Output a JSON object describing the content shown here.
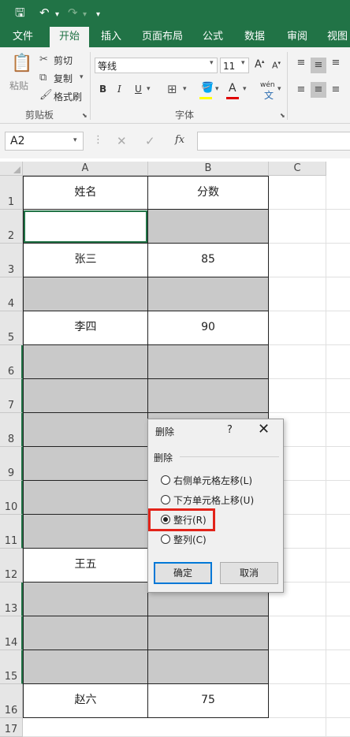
{
  "quick_access": {
    "save_icon": "save-icon",
    "undo_icon": "undo-icon",
    "redo_icon": "redo-icon",
    "customize_icon": "chevron-down-icon"
  },
  "tabs": [
    {
      "label": "文件"
    },
    {
      "label": "开始"
    },
    {
      "label": "插入"
    },
    {
      "label": "页面布局"
    },
    {
      "label": "公式"
    },
    {
      "label": "数据"
    },
    {
      "label": "审阅"
    },
    {
      "label": "视图"
    }
  ],
  "ribbon": {
    "clipboard": {
      "paste": "粘贴",
      "cut": "剪切",
      "copy": "复制",
      "format_painter": "格式刷",
      "group_label": "剪贴板"
    },
    "font": {
      "font_name": "等线",
      "font_size": "11",
      "bold": "B",
      "italic": "I",
      "underline": "U",
      "phonetic": "wén",
      "group_label": "字体"
    }
  },
  "formula_bar": {
    "name_box": "A2",
    "cancel": "✕",
    "enter": "✓",
    "fx": "fx",
    "value": ""
  },
  "sheet": {
    "columns": [
      "A",
      "B",
      "C"
    ],
    "rows": [
      {
        "num": "1",
        "a": "姓名",
        "b": "分数"
      },
      {
        "num": "2",
        "a": "",
        "b": ""
      },
      {
        "num": "3",
        "a": "张三",
        "b": "85"
      },
      {
        "num": "4",
        "a": "",
        "b": ""
      },
      {
        "num": "5",
        "a": "李四",
        "b": "90"
      },
      {
        "num": "6",
        "a": "",
        "b": ""
      },
      {
        "num": "7",
        "a": "",
        "b": ""
      },
      {
        "num": "8",
        "a": "",
        "b": ""
      },
      {
        "num": "9",
        "a": "",
        "b": ""
      },
      {
        "num": "10",
        "a": "",
        "b": ""
      },
      {
        "num": "11",
        "a": "",
        "b": ""
      },
      {
        "num": "12",
        "a": "王五",
        "b": ""
      },
      {
        "num": "13",
        "a": "",
        "b": ""
      },
      {
        "num": "14",
        "a": "",
        "b": ""
      },
      {
        "num": "15",
        "a": "",
        "b": ""
      },
      {
        "num": "16",
        "a": "赵六",
        "b": "75"
      },
      {
        "num": "17",
        "a": "",
        "b": ""
      }
    ]
  },
  "dialog": {
    "title": "删除",
    "help": "?",
    "close": "✕",
    "group": "删除",
    "options": [
      {
        "label": "右侧单元格左移(L)",
        "selected": false
      },
      {
        "label": "下方单元格上移(U)",
        "selected": false
      },
      {
        "label": "整行(R)",
        "selected": true
      },
      {
        "label": "整列(C)",
        "selected": false
      }
    ],
    "ok": "确定",
    "cancel": "取消"
  },
  "colors": {
    "excel_green": "#217346",
    "gray_fill": "#c9c9c9",
    "highlight_red": "#e2231a"
  }
}
